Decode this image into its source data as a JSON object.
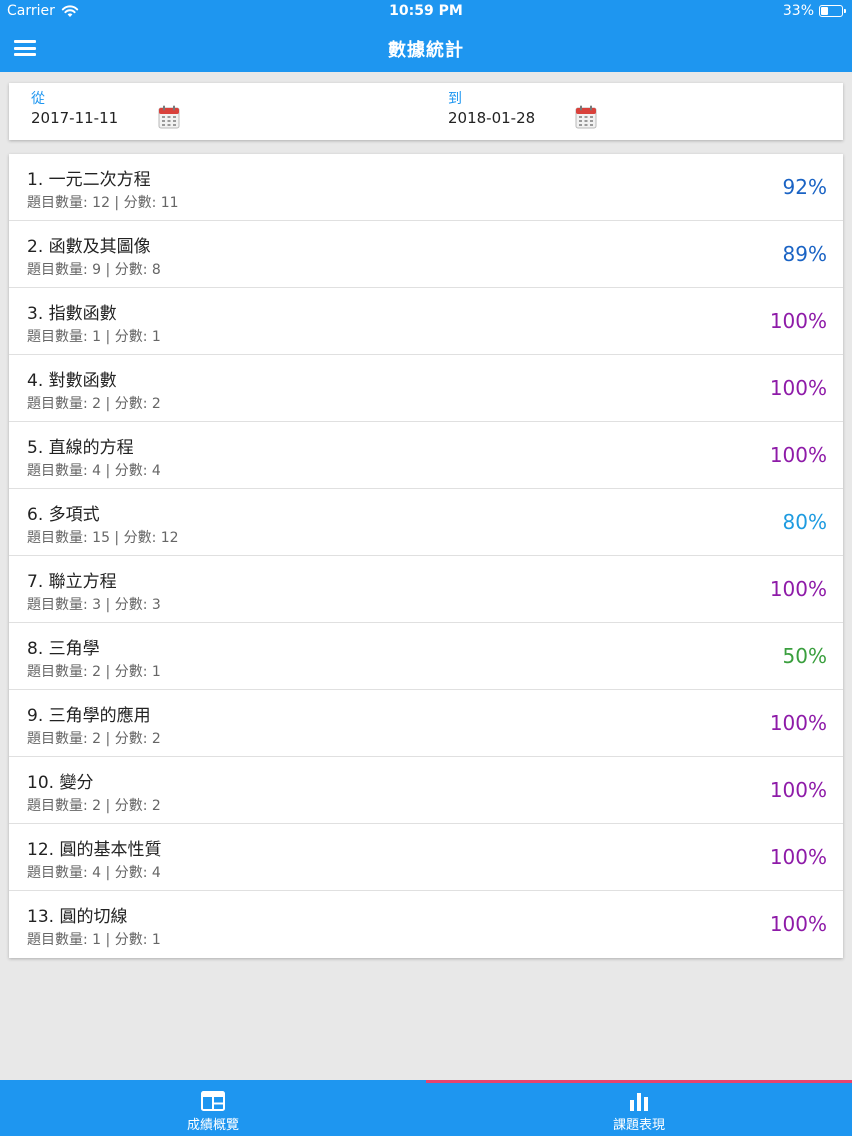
{
  "status_bar": {
    "carrier": "Carrier",
    "time": "10:59 PM",
    "battery": "33%"
  },
  "nav": {
    "title": "數據統計",
    "menu_icon": "hamburger-menu-icon"
  },
  "date_filter": {
    "from_label": "從",
    "from_value": "2017-11-11",
    "to_label": "到",
    "to_value": "2018-01-28",
    "icon": "calendar-icon"
  },
  "topics": [
    {
      "name": "1. 一元二次方程",
      "stats": "題目數量: 12 | 分數: 11",
      "percent": "92%",
      "color": "#1a63c4"
    },
    {
      "name": "2. 函數及其圖像",
      "stats": "題目數量: 9 | 分數: 8",
      "percent": "89%",
      "color": "#1a63c4"
    },
    {
      "name": "3. 指數函數",
      "stats": "題目數量: 1 | 分數: 1",
      "percent": "100%",
      "color": "#8e1ba8"
    },
    {
      "name": "4. 對數函數",
      "stats": "題目數量: 2 | 分數: 2",
      "percent": "100%",
      "color": "#8e1ba8"
    },
    {
      "name": "5. 直線的方程",
      "stats": "題目數量: 4 | 分數: 4",
      "percent": "100%",
      "color": "#8e1ba8"
    },
    {
      "name": "6. 多項式",
      "stats": "題目數量: 15 | 分數: 12",
      "percent": "80%",
      "color": "#1e9be0"
    },
    {
      "name": "7. 聯立方程",
      "stats": "題目數量: 3 | 分數: 3",
      "percent": "100%",
      "color": "#8e1ba8"
    },
    {
      "name": "8. 三角學",
      "stats": "題目數量: 2 | 分數: 1",
      "percent": "50%",
      "color": "#3a9f3e"
    },
    {
      "name": "9. 三角學的應用",
      "stats": "題目數量: 2 | 分數: 2",
      "percent": "100%",
      "color": "#8e1ba8"
    },
    {
      "name": "10. 變分",
      "stats": "題目數量: 2 | 分數: 2",
      "percent": "100%",
      "color": "#8e1ba8"
    },
    {
      "name": "12. 圓的基本性質",
      "stats": "題目數量: 4 | 分數: 4",
      "percent": "100%",
      "color": "#8e1ba8"
    },
    {
      "name": "13. 圓的切線",
      "stats": "題目數量: 1 | 分數: 1",
      "percent": "100%",
      "color": "#8e1ba8"
    }
  ],
  "tabs": [
    {
      "label": "成績概覽",
      "icon": "dashboard-icon",
      "active": false
    },
    {
      "label": "課題表現",
      "icon": "bar-chart-icon",
      "active": true
    }
  ],
  "colors": {
    "primary": "#1e96f0",
    "tab_indicator": "#e8436e"
  }
}
